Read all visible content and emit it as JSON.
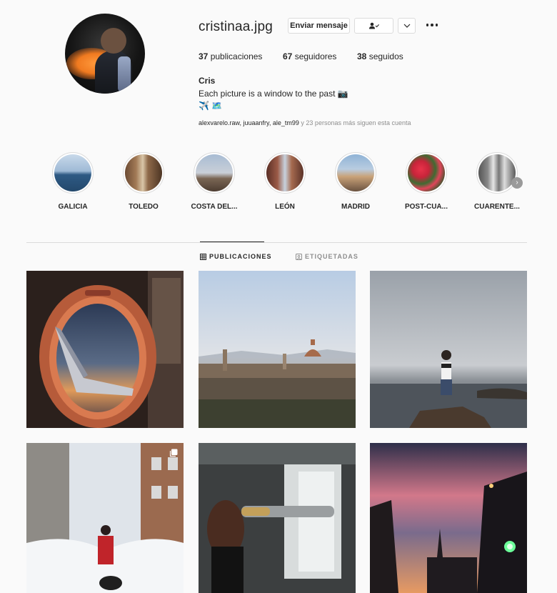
{
  "profile": {
    "username": "cristinaa.jpg",
    "message_button": "Enviar mensaje",
    "follow_icon": "person-check-icon",
    "dropdown_icon": "chevron-down-icon",
    "more_icon": "more-horizontal-icon",
    "stats": {
      "posts_count": "37",
      "posts_label": "publicaciones",
      "followers_count": "67",
      "followers_label": "seguidores",
      "following_count": "38",
      "following_label": "seguidos"
    },
    "bio": {
      "name": "Cris",
      "line1": "Each picture is a window to the past 📷",
      "line2": "✈️ 🗺️"
    },
    "followed_by": {
      "names": "alexvarelo.raw, juuaanfry, ale_tm99",
      "rest": " y 23 personas más siguen esta cuenta"
    }
  },
  "highlights": [
    {
      "label": "GALICIA"
    },
    {
      "label": "TOLEDO"
    },
    {
      "label": "COSTA DEL..."
    },
    {
      "label": "LEÓN"
    },
    {
      "label": "MADRID"
    },
    {
      "label": "POST-CUA..."
    },
    {
      "label": "CUARENTE..."
    }
  ],
  "tabs": {
    "posts": "PUBLICACIONES",
    "tagged": "ETIQUETADAS"
  },
  "colors": {
    "text": "#262626",
    "muted": "#8e8e8e",
    "border": "#dbdbdb",
    "background": "#fafafa"
  }
}
